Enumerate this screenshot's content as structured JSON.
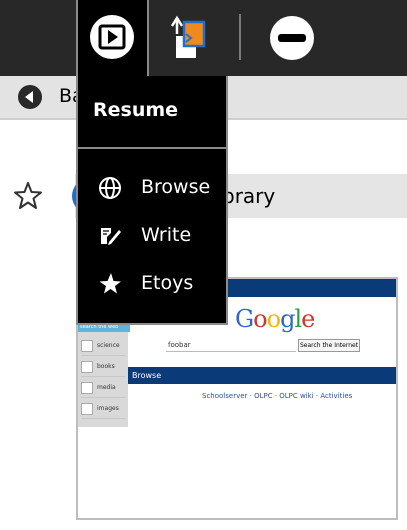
{
  "menu": {
    "title": "Resume",
    "items": [
      {
        "label": "Browse",
        "icon": "globe-icon"
      },
      {
        "label": "Write",
        "icon": "write-icon"
      },
      {
        "label": "Etoys",
        "icon": "star-icon"
      }
    ]
  },
  "toolbar": {
    "back_label": "Ba"
  },
  "urlbar": {
    "text": "brary"
  },
  "thumbnail": {
    "logo": "Google",
    "query": "foobar",
    "search_button": "Search the Internet",
    "sidebar_header": "search the web",
    "sidebar_items": [
      "science",
      "books",
      "media",
      "images"
    ],
    "section": "Browse",
    "links": "Schoolserver · OLPC · OLPC wiki · Activities"
  },
  "colors": {
    "frame": "#282828",
    "accent": "#1f6fd1",
    "google_blue": "#3366cc"
  }
}
